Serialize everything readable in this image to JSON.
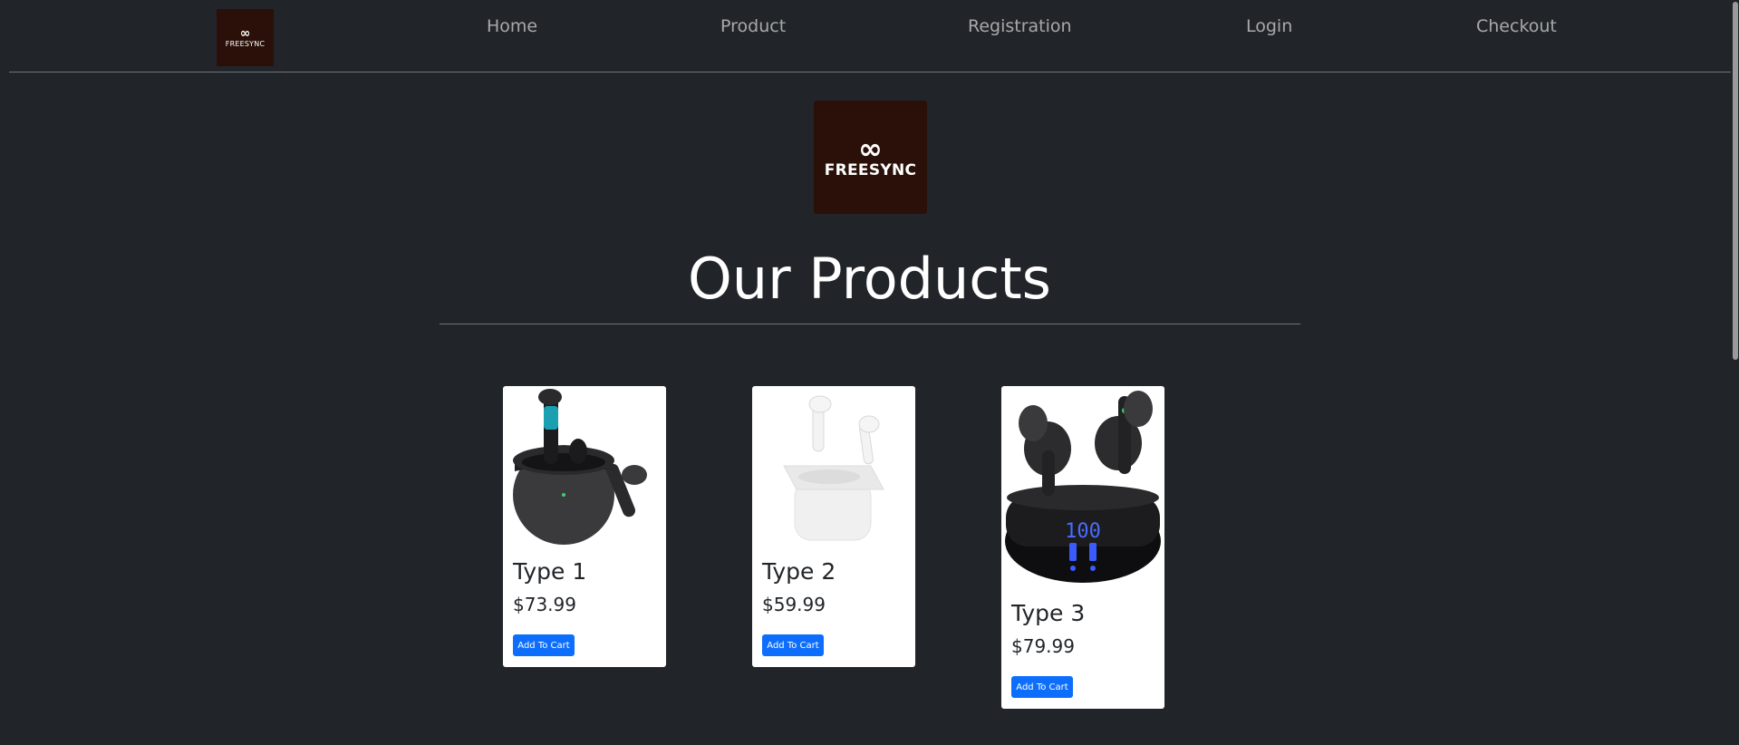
{
  "nav": {
    "logo_text": "FREESYNC",
    "links": [
      "Home",
      "Product",
      "Registration",
      "Login",
      "Checkout"
    ]
  },
  "hero": {
    "logo_text": "FREESYNC",
    "title": "Our Products"
  },
  "products": [
    {
      "name": "Type 1",
      "price": "$73.99",
      "button": "Add To Cart",
      "image": "black-earbuds-icon"
    },
    {
      "name": "Type 2",
      "price": "$59.99",
      "button": "Add To Cart",
      "image": "white-earbuds-icon"
    },
    {
      "name": "Type 3",
      "price": "$79.99",
      "button": "Add To Cart",
      "image": "black-earbuds-led-case-icon"
    }
  ],
  "colors": {
    "background": "#212529",
    "logo_bg": "#2a1008",
    "button": "#0d6efd",
    "nav_link": "rgba(255,255,255,0.6)"
  }
}
